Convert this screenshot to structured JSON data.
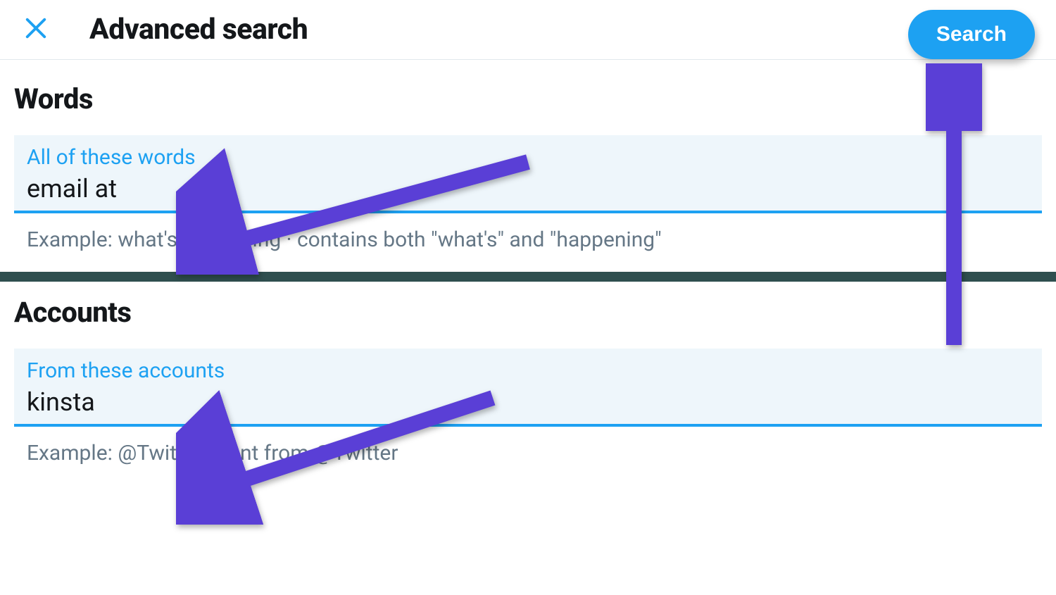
{
  "header": {
    "title": "Advanced search",
    "search_button_label": "Search"
  },
  "words_section": {
    "title": "Words",
    "all_words": {
      "label": "All of these words",
      "value": "email at",
      "example": "Example: what's happening · contains both \"what's\" and \"happening\""
    }
  },
  "accounts_section": {
    "title": "Accounts",
    "from_accounts": {
      "label": "From these accounts",
      "value": "kinsta",
      "example": "Example: @Twitter · sent from @Twitter"
    }
  },
  "colors": {
    "accent": "#1da1f2",
    "text_primary": "#14171a",
    "text_secondary": "#657786",
    "field_bg": "#eef6fb",
    "annotation_arrow": "#5a3fd6"
  },
  "icons": {
    "close": "close-icon"
  }
}
